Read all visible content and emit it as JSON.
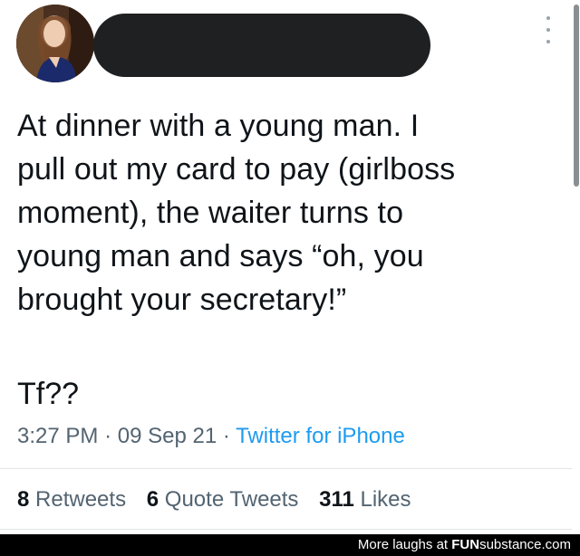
{
  "tweet": {
    "author_avatar": "profile-photo",
    "author_name_redacted": true,
    "text": "At dinner with a young man. I\npull out my card to pay (girlboss\nmoment), the waiter turns to\nyoung man and says “oh, you\nbrought your secretary!”",
    "text_tail": "Tf??",
    "time": "3:27 PM",
    "separator": "·",
    "date": "09 Sep 21",
    "source": "Twitter for iPhone"
  },
  "stats": {
    "retweets_count": "8",
    "retweets_label": "Retweets",
    "quotes_count": "6",
    "quotes_label": "Quote Tweets",
    "likes_count": "311",
    "likes_label": "Likes"
  },
  "watermark": {
    "prefix": "More laughs at",
    "brand_bold": "FUN",
    "brand_rest": "substance",
    "brand_suffix": ".com"
  },
  "colors": {
    "text_primary": "#0f1419",
    "text_secondary": "#536471",
    "link": "#1d9bf0",
    "redaction": "#1f2021"
  },
  "icons": {
    "more": "more-options-icon"
  }
}
